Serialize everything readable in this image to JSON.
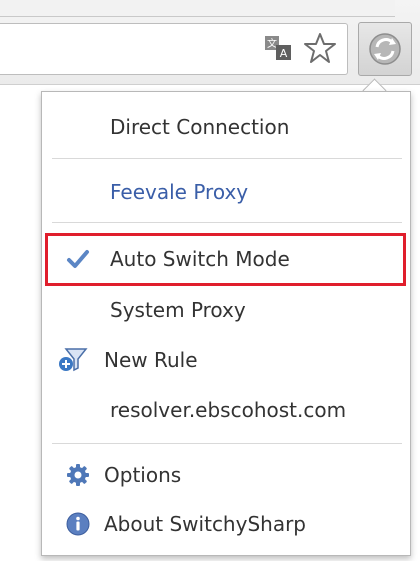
{
  "toolbar": {
    "translate_icon": "translate-icon",
    "bookmark_icon": "star-icon",
    "extension_icon": "switchysharp-icon"
  },
  "menu": {
    "direct_connection": "Direct Connection",
    "profile": "Feevale Proxy",
    "auto_switch": "Auto Switch Mode",
    "system_proxy": "System Proxy",
    "new_rule": "New Rule",
    "resolver": "resolver.ebscohost.com",
    "options": "Options",
    "about": "About SwitchySharp"
  },
  "colors": {
    "profile_text": "#3a5ea8",
    "highlight_border": "#e01e2c",
    "check_mark": "#5b86c5"
  }
}
